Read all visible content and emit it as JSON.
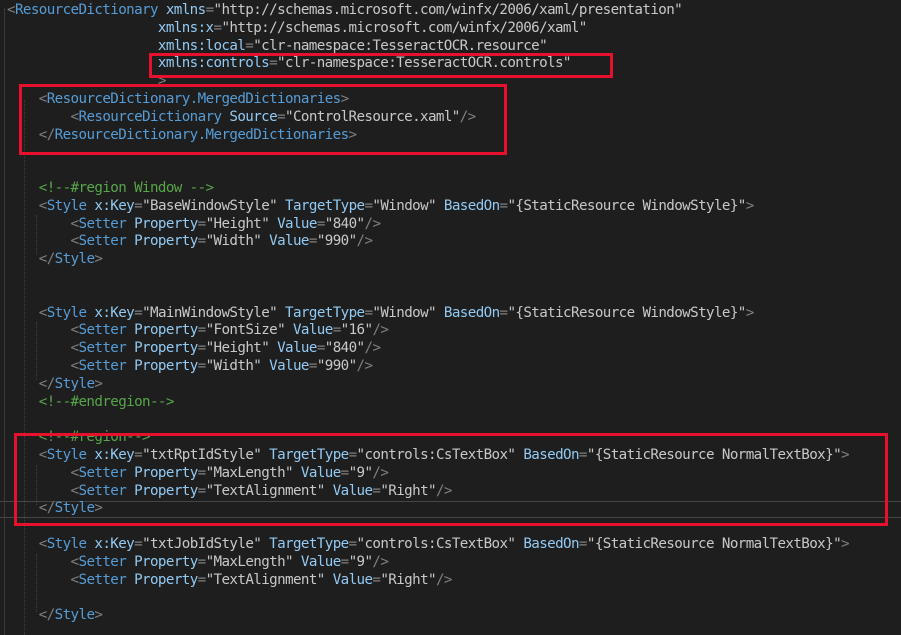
{
  "editor": {
    "language": "XAML",
    "theme_colors": {
      "background": "#1e1e1e",
      "element": "#569cd6",
      "attribute": "#92caf4",
      "value": "#c8c8c8",
      "comment": "#57a64a",
      "punctuation": "#808080",
      "highlight_box": "#e8112d"
    },
    "lines": [
      [
        [
          "p",
          "<"
        ],
        [
          "e",
          "ResourceDictionary"
        ],
        [
          "t",
          " "
        ],
        [
          "a",
          "xmlns"
        ],
        [
          "p",
          "="
        ],
        [
          "s",
          "\"http://schemas.microsoft.com/winfx/2006/xaml/presentation\""
        ]
      ],
      [
        [
          "t",
          "                   "
        ],
        [
          "a",
          "xmlns:x"
        ],
        [
          "p",
          "="
        ],
        [
          "s",
          "\"http://schemas.microsoft.com/winfx/2006/xaml\""
        ]
      ],
      [
        [
          "t",
          "                   "
        ],
        [
          "a",
          "xmlns:local"
        ],
        [
          "p",
          "="
        ],
        [
          "s",
          "\"clr-namespace:TesseractOCR.resource\""
        ]
      ],
      [
        [
          "t",
          "                   "
        ],
        [
          "a",
          "xmlns:controls"
        ],
        [
          "p",
          "="
        ],
        [
          "s",
          "\"clr-namespace:TesseractOCR.controls\""
        ]
      ],
      [
        [
          "t",
          "                   "
        ],
        [
          "p",
          ">"
        ]
      ],
      [
        [
          "t",
          "    "
        ],
        [
          "p",
          "<"
        ],
        [
          "e",
          "ResourceDictionary.MergedDictionaries"
        ],
        [
          "p",
          ">"
        ]
      ],
      [
        [
          "t",
          "        "
        ],
        [
          "p",
          "<"
        ],
        [
          "e",
          "ResourceDictionary"
        ],
        [
          "t",
          " "
        ],
        [
          "a",
          "Source"
        ],
        [
          "p",
          "="
        ],
        [
          "s",
          "\"ControlResource.xaml\""
        ],
        [
          "p",
          "/>"
        ]
      ],
      [
        [
          "t",
          "    "
        ],
        [
          "p",
          "</"
        ],
        [
          "e",
          "ResourceDictionary.MergedDictionaries"
        ],
        [
          "p",
          ">"
        ]
      ],
      [],
      [],
      [
        [
          "t",
          "    "
        ],
        [
          "c",
          "<!--#region Window -->"
        ]
      ],
      [
        [
          "t",
          "    "
        ],
        [
          "p",
          "<"
        ],
        [
          "e",
          "Style"
        ],
        [
          "t",
          " "
        ],
        [
          "a",
          "x:Key"
        ],
        [
          "p",
          "="
        ],
        [
          "s",
          "\"BaseWindowStyle\""
        ],
        [
          "t",
          " "
        ],
        [
          "a",
          "TargetType"
        ],
        [
          "p",
          "="
        ],
        [
          "s",
          "\"Window\""
        ],
        [
          "t",
          " "
        ],
        [
          "a",
          "BasedOn"
        ],
        [
          "p",
          "="
        ],
        [
          "s",
          "\"{StaticResource WindowStyle}\""
        ],
        [
          "p",
          ">"
        ]
      ],
      [
        [
          "t",
          "        "
        ],
        [
          "p",
          "<"
        ],
        [
          "e",
          "Setter"
        ],
        [
          "t",
          " "
        ],
        [
          "a",
          "Property"
        ],
        [
          "p",
          "="
        ],
        [
          "s",
          "\"Height\""
        ],
        [
          "t",
          " "
        ],
        [
          "a",
          "Value"
        ],
        [
          "p",
          "="
        ],
        [
          "s",
          "\"840\""
        ],
        [
          "p",
          "/>"
        ]
      ],
      [
        [
          "t",
          "        "
        ],
        [
          "p",
          "<"
        ],
        [
          "e",
          "Setter"
        ],
        [
          "t",
          " "
        ],
        [
          "a",
          "Property"
        ],
        [
          "p",
          "="
        ],
        [
          "s",
          "\"Width\""
        ],
        [
          "t",
          " "
        ],
        [
          "a",
          "Value"
        ],
        [
          "p",
          "="
        ],
        [
          "s",
          "\"990\""
        ],
        [
          "p",
          "/>"
        ]
      ],
      [
        [
          "t",
          "    "
        ],
        [
          "p",
          "</"
        ],
        [
          "e",
          "Style"
        ],
        [
          "p",
          ">"
        ]
      ],
      [],
      [],
      [
        [
          "t",
          "    "
        ],
        [
          "p",
          "<"
        ],
        [
          "e",
          "Style"
        ],
        [
          "t",
          " "
        ],
        [
          "a",
          "x:Key"
        ],
        [
          "p",
          "="
        ],
        [
          "s",
          "\"MainWindowStyle\""
        ],
        [
          "t",
          " "
        ],
        [
          "a",
          "TargetType"
        ],
        [
          "p",
          "="
        ],
        [
          "s",
          "\"Window\""
        ],
        [
          "t",
          " "
        ],
        [
          "a",
          "BasedOn"
        ],
        [
          "p",
          "="
        ],
        [
          "s",
          "\"{StaticResource WindowStyle}\""
        ],
        [
          "p",
          ">"
        ]
      ],
      [
        [
          "t",
          "        "
        ],
        [
          "p",
          "<"
        ],
        [
          "e",
          "Setter"
        ],
        [
          "t",
          " "
        ],
        [
          "a",
          "Property"
        ],
        [
          "p",
          "="
        ],
        [
          "s",
          "\"FontSize\""
        ],
        [
          "t",
          " "
        ],
        [
          "a",
          "Value"
        ],
        [
          "p",
          "="
        ],
        [
          "s",
          "\"16\""
        ],
        [
          "p",
          "/>"
        ]
      ],
      [
        [
          "t",
          "        "
        ],
        [
          "p",
          "<"
        ],
        [
          "e",
          "Setter"
        ],
        [
          "t",
          " "
        ],
        [
          "a",
          "Property"
        ],
        [
          "p",
          "="
        ],
        [
          "s",
          "\"Height\""
        ],
        [
          "t",
          " "
        ],
        [
          "a",
          "Value"
        ],
        [
          "p",
          "="
        ],
        [
          "s",
          "\"840\""
        ],
        [
          "p",
          "/>"
        ]
      ],
      [
        [
          "t",
          "        "
        ],
        [
          "p",
          "<"
        ],
        [
          "e",
          "Setter"
        ],
        [
          "t",
          " "
        ],
        [
          "a",
          "Property"
        ],
        [
          "p",
          "="
        ],
        [
          "s",
          "\"Width\""
        ],
        [
          "t",
          " "
        ],
        [
          "a",
          "Value"
        ],
        [
          "p",
          "="
        ],
        [
          "s",
          "\"990\""
        ],
        [
          "p",
          "/>"
        ]
      ],
      [
        [
          "t",
          "    "
        ],
        [
          "p",
          "</"
        ],
        [
          "e",
          "Style"
        ],
        [
          "p",
          ">"
        ]
      ],
      [
        [
          "t",
          "    "
        ],
        [
          "c",
          "<!--#endregion-->"
        ]
      ],
      [],
      [
        [
          "t",
          "    "
        ],
        [
          "c",
          "<!--#region-->"
        ]
      ],
      [
        [
          "t",
          "    "
        ],
        [
          "p",
          "<"
        ],
        [
          "e",
          "Style"
        ],
        [
          "t",
          " "
        ],
        [
          "a",
          "x:Key"
        ],
        [
          "p",
          "="
        ],
        [
          "s",
          "\"txtRptIdStyle\""
        ],
        [
          "t",
          " "
        ],
        [
          "a",
          "TargetType"
        ],
        [
          "p",
          "="
        ],
        [
          "s",
          "\"controls:CsTextBox\""
        ],
        [
          "t",
          " "
        ],
        [
          "a",
          "BasedOn"
        ],
        [
          "p",
          "="
        ],
        [
          "s",
          "\"{StaticResource NormalTextBox}\""
        ],
        [
          "p",
          ">"
        ]
      ],
      [
        [
          "t",
          "        "
        ],
        [
          "p",
          "<"
        ],
        [
          "e",
          "Setter"
        ],
        [
          "t",
          " "
        ],
        [
          "a",
          "Property"
        ],
        [
          "p",
          "="
        ],
        [
          "s",
          "\"MaxLength\""
        ],
        [
          "t",
          " "
        ],
        [
          "a",
          "Value"
        ],
        [
          "p",
          "="
        ],
        [
          "s",
          "\"9\""
        ],
        [
          "p",
          "/>"
        ]
      ],
      [
        [
          "t",
          "        "
        ],
        [
          "p",
          "<"
        ],
        [
          "e",
          "Setter"
        ],
        [
          "t",
          " "
        ],
        [
          "a",
          "Property"
        ],
        [
          "p",
          "="
        ],
        [
          "s",
          "\"TextAlignment\""
        ],
        [
          "t",
          " "
        ],
        [
          "a",
          "Value"
        ],
        [
          "p",
          "="
        ],
        [
          "s",
          "\"Right\""
        ],
        [
          "p",
          "/>"
        ]
      ],
      [
        [
          "t",
          "    "
        ],
        [
          "p",
          "</"
        ],
        [
          "e",
          "Style"
        ],
        [
          "p",
          ">"
        ]
      ],
      [],
      [
        [
          "t",
          "    "
        ],
        [
          "p",
          "<"
        ],
        [
          "e",
          "Style"
        ],
        [
          "t",
          " "
        ],
        [
          "a",
          "x:Key"
        ],
        [
          "p",
          "="
        ],
        [
          "s",
          "\"txtJobIdStyle\""
        ],
        [
          "t",
          " "
        ],
        [
          "a",
          "TargetType"
        ],
        [
          "p",
          "="
        ],
        [
          "s",
          "\"controls:CsTextBox\""
        ],
        [
          "t",
          " "
        ],
        [
          "a",
          "BasedOn"
        ],
        [
          "p",
          "="
        ],
        [
          "s",
          "\"{StaticResource NormalTextBox}\""
        ],
        [
          "p",
          ">"
        ]
      ],
      [
        [
          "t",
          "        "
        ],
        [
          "p",
          "<"
        ],
        [
          "e",
          "Setter"
        ],
        [
          "t",
          " "
        ],
        [
          "a",
          "Property"
        ],
        [
          "p",
          "="
        ],
        [
          "s",
          "\"MaxLength\""
        ],
        [
          "t",
          " "
        ],
        [
          "a",
          "Value"
        ],
        [
          "p",
          "="
        ],
        [
          "s",
          "\"9\""
        ],
        [
          "p",
          "/>"
        ]
      ],
      [
        [
          "t",
          "        "
        ],
        [
          "p",
          "<"
        ],
        [
          "e",
          "Setter"
        ],
        [
          "t",
          " "
        ],
        [
          "a",
          "Property"
        ],
        [
          "p",
          "="
        ],
        [
          "s",
          "\"TextAlignment\""
        ],
        [
          "t",
          " "
        ],
        [
          "a",
          "Value"
        ],
        [
          "p",
          "="
        ],
        [
          "s",
          "\"Right\""
        ],
        [
          "p",
          "/>"
        ]
      ],
      [],
      [
        [
          "t",
          "    "
        ],
        [
          "p",
          "</"
        ],
        [
          "e",
          "Style"
        ],
        [
          "p",
          ">"
        ]
      ]
    ]
  }
}
